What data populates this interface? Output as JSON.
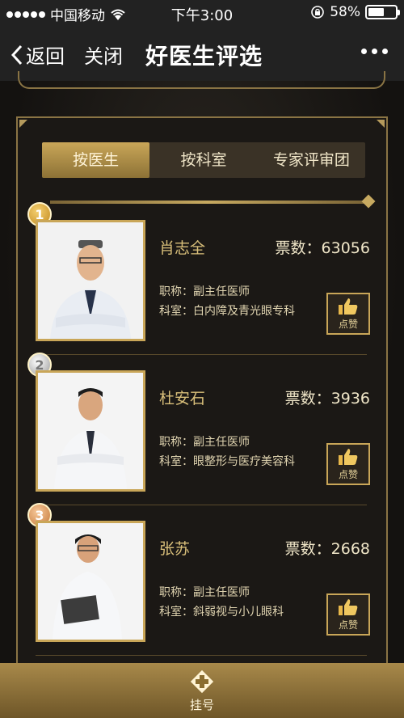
{
  "status_bar": {
    "carrier": "中国移动",
    "time": "下午3:00",
    "battery_text": "58%",
    "battery_level": 0.58
  },
  "nav": {
    "back_label": "返回",
    "close_label": "关闭",
    "title": "好医生评选"
  },
  "tabs": [
    {
      "label": "按医生",
      "active": true
    },
    {
      "label": "按科室",
      "active": false
    },
    {
      "label": "专家评审团",
      "active": false
    }
  ],
  "doctors": [
    {
      "rank": "1",
      "name": "肖志全",
      "votes_label": "票数：63056",
      "title": "职称：副主任医师",
      "dept": "科室：白内障及青光眼专科",
      "like_label": "点赞"
    },
    {
      "rank": "2",
      "name": "杜安石",
      "votes_label": "票数：3936",
      "title": "职称：副主任医师",
      "dept": "科室：眼整形与医疗美容科",
      "like_label": "点赞"
    },
    {
      "rank": "3",
      "name": "张苏",
      "votes_label": "票数：2668",
      "title": "职称：副主任医师",
      "dept": "科室：斜弱视与小儿眼科",
      "like_label": "点赞"
    }
  ],
  "bottom_bar": {
    "label": "挂号"
  },
  "colors": {
    "gold": "#c9a658",
    "dark": "#1b1815"
  }
}
